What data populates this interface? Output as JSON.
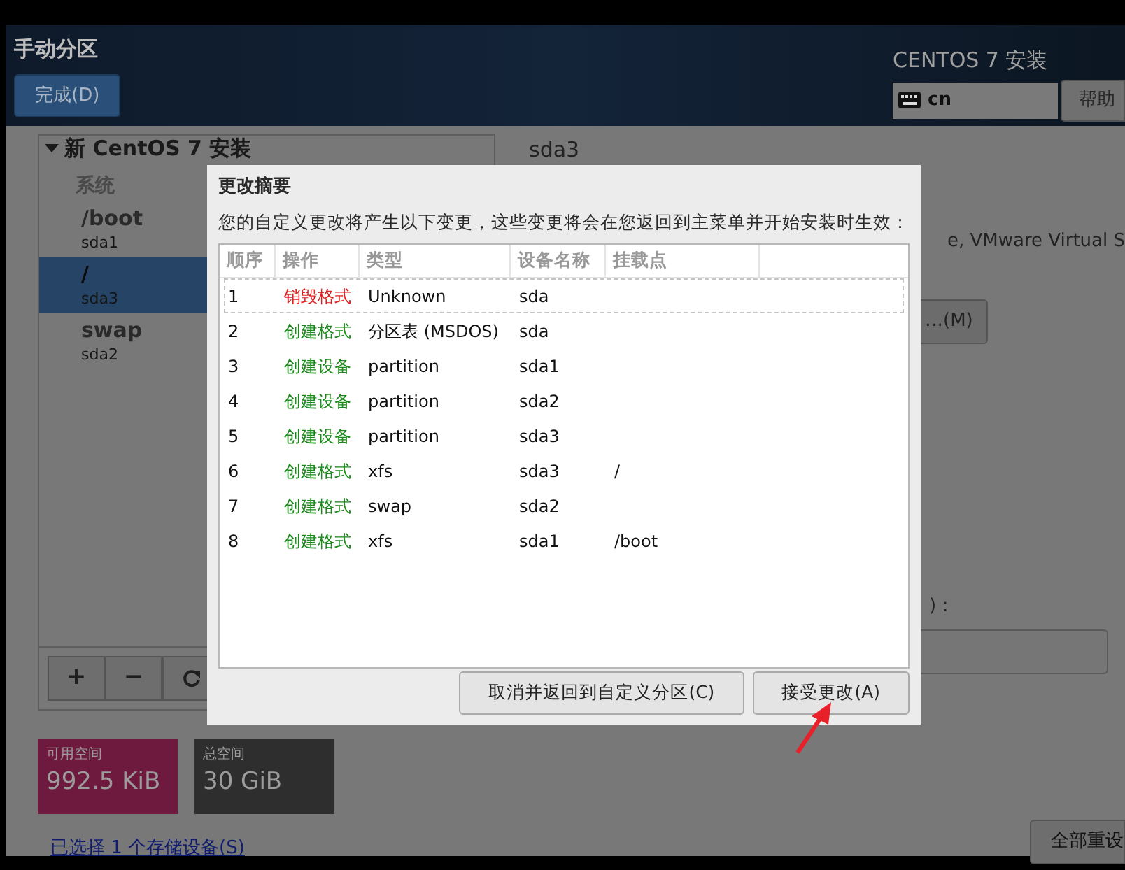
{
  "header": {
    "title": "手动分区",
    "done_button": "完成(D)",
    "product": "CENTOS 7 安装",
    "keyboard": "cn",
    "help_button": "帮助"
  },
  "sidebar": {
    "group": "新 CentOS 7 安装",
    "expanded": true,
    "category": "系统",
    "items": [
      {
        "mount": "/boot",
        "device": "sda1",
        "selected": false
      },
      {
        "mount": "/",
        "device": "sda3",
        "selected": true
      },
      {
        "mount": "swap",
        "device": "sda2",
        "selected": false
      }
    ],
    "toolbar": [
      "+",
      "−"
    ]
  },
  "space": [
    {
      "label": "可用空间",
      "value": "992.5 KiB",
      "color": "#6e1a3e"
    },
    {
      "label": "总空间",
      "value": "30 GiB",
      "color": "#2e2e2e"
    }
  ],
  "storage_link": "已选择 1 个存储设备(S)",
  "details": {
    "title": "sda3",
    "device_text": "e, VMware Virtual S",
    "modify_button": "…(M)",
    "label_tail": ")：",
    "reset_button": "全部重设"
  },
  "dialog": {
    "title": "更改摘要",
    "description": "您的自定义更改将产生以下变更，这些变更将会在您返回到主菜单并开始安装时生效：",
    "columns": [
      "顺序",
      "操作",
      "类型",
      "设备名称",
      "挂载点"
    ],
    "rows": [
      {
        "order": "1",
        "action": "销毁格式",
        "kind": "destroy",
        "type": "Unknown",
        "device": "sda",
        "mount": "",
        "focused": true
      },
      {
        "order": "2",
        "action": "创建格式",
        "kind": "create",
        "type": "分区表 (MSDOS)",
        "device": "sda",
        "mount": "",
        "focused": false
      },
      {
        "order": "3",
        "action": "创建设备",
        "kind": "create",
        "type": "partition",
        "device": "sda1",
        "mount": "",
        "focused": false
      },
      {
        "order": "4",
        "action": "创建设备",
        "kind": "create",
        "type": "partition",
        "device": "sda2",
        "mount": "",
        "focused": false
      },
      {
        "order": "5",
        "action": "创建设备",
        "kind": "create",
        "type": "partition",
        "device": "sda3",
        "mount": "",
        "focused": false
      },
      {
        "order": "6",
        "action": "创建格式",
        "kind": "create",
        "type": "xfs",
        "device": "sda3",
        "mount": "/",
        "focused": false
      },
      {
        "order": "7",
        "action": "创建格式",
        "kind": "create",
        "type": "swap",
        "device": "sda2",
        "mount": "",
        "focused": false
      },
      {
        "order": "8",
        "action": "创建格式",
        "kind": "create",
        "type": "xfs",
        "device": "sda1",
        "mount": "/boot",
        "focused": false
      }
    ],
    "buttons": [
      "取消并返回到自定义分区(C)",
      "接受更改(A)"
    ]
  }
}
